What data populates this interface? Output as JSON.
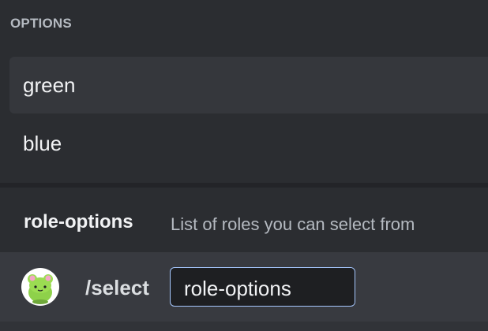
{
  "autocomplete": {
    "section_header": "OPTIONS",
    "options": [
      {
        "label": "green",
        "selected": true
      },
      {
        "label": "blue",
        "selected": false
      }
    ]
  },
  "parameter_hint": {
    "name": "role-options",
    "description": "List of roles you can select from"
  },
  "command_bar": {
    "avatar_icon": "frog-app-avatar-icon",
    "command": "/select",
    "parameter_label": "role-options",
    "parameter_value": ""
  },
  "colors": {
    "background": "#2b2d31",
    "selected_option": "#35373c",
    "command_bar": "#383a40",
    "pill_border": "#a6c8ff",
    "pill_background": "#1e1f22",
    "avatar_frog": "#8ed14a"
  }
}
